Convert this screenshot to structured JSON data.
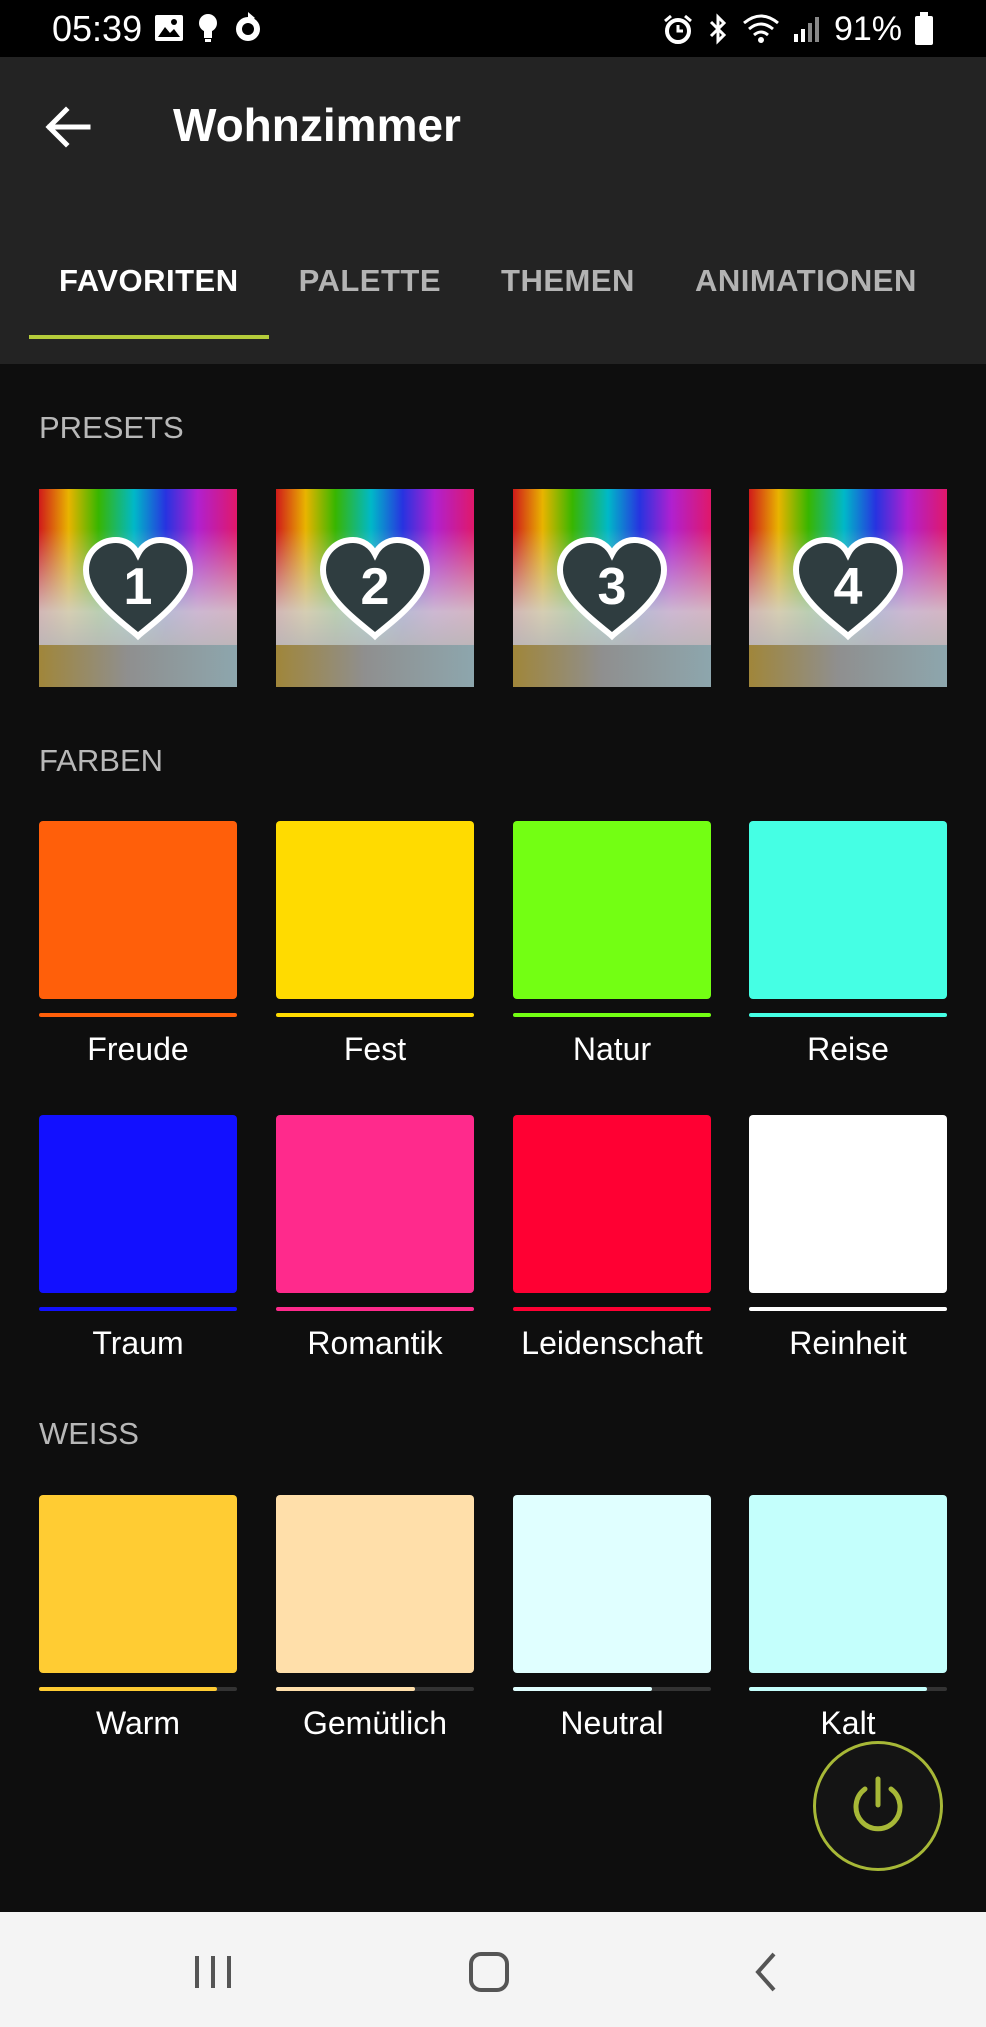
{
  "status_bar": {
    "time": "05:39",
    "battery_text": "91%",
    "left_icons": [
      "image-icon",
      "bulb-icon",
      "sync-icon"
    ],
    "right_icons": [
      "alarm-icon",
      "bluetooth-icon",
      "wifi-icon",
      "signal-icon",
      "battery-icon"
    ]
  },
  "app_bar": {
    "title": "Wohnzimmer",
    "back_icon": "arrow-left-icon"
  },
  "tabs": [
    {
      "label": "FAVORITEN",
      "active": true
    },
    {
      "label": "PALETTE",
      "active": false
    },
    {
      "label": "THEMEN",
      "active": false
    },
    {
      "label": "ANIMATIONEN",
      "active": false
    }
  ],
  "sections": {
    "presets": {
      "label": "PRESETS",
      "items": [
        {
          "number": "1"
        },
        {
          "number": "2"
        },
        {
          "number": "3"
        },
        {
          "number": "4"
        }
      ]
    },
    "farben": {
      "label": "FARBEN",
      "items": [
        {
          "label": "Freude",
          "color": "#ff5f0a"
        },
        {
          "label": "Fest",
          "color": "#ffdb00"
        },
        {
          "label": "Natur",
          "color": "#73ff13"
        },
        {
          "label": "Reise",
          "color": "#45ffe4"
        },
        {
          "label": "Traum",
          "color": "#1210ff"
        },
        {
          "label": "Romantik",
          "color": "#ff2a8c"
        },
        {
          "label": "Leidenschaft",
          "color": "#ff0033"
        },
        {
          "label": "Reinheit",
          "color": "#ffffff"
        }
      ]
    },
    "weiss": {
      "label": "WEISS",
      "items": [
        {
          "label": "Warm",
          "color": "#ffcc33",
          "level": 0.9
        },
        {
          "label": "Gemütlich",
          "color": "#ffdfaa",
          "level": 0.7
        },
        {
          "label": "Neutral",
          "color": "#e0ffff",
          "level": 0.7
        },
        {
          "label": "Kalt",
          "color": "#c4fffc",
          "level": 0.9
        }
      ]
    }
  },
  "fab": {
    "icon": "power-icon",
    "color": "#a7b837"
  },
  "nav_bar": {
    "icons": [
      "recent-apps-icon",
      "home-icon",
      "back-icon"
    ]
  },
  "accent_color": "#b5cc3a"
}
